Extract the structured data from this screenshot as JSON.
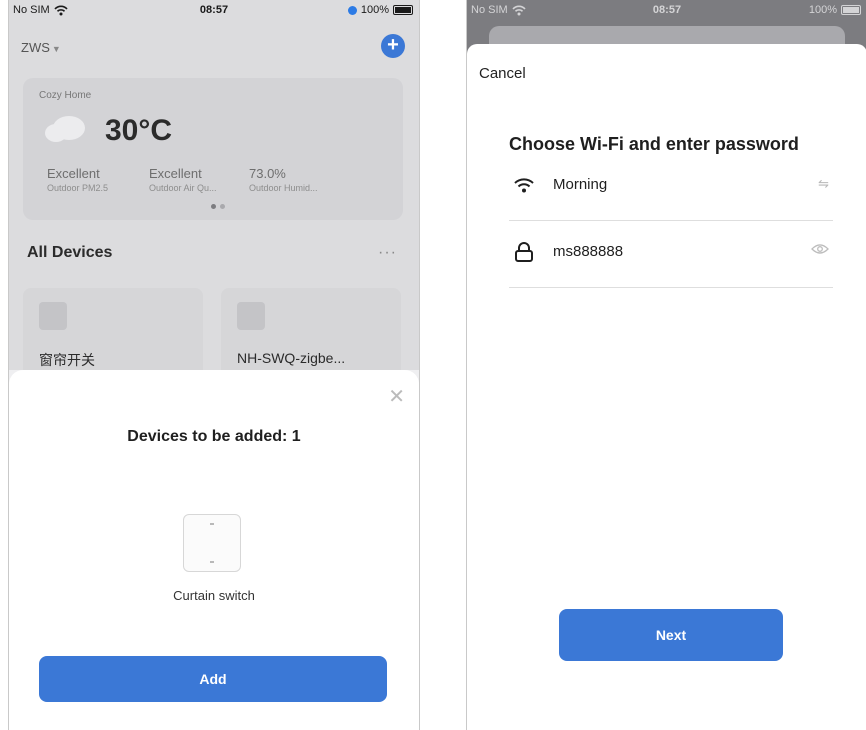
{
  "left_phone": {
    "status": {
      "carrier": "No SIM",
      "time": "08:57",
      "battery": "100%"
    },
    "home": {
      "name": "ZWS",
      "weather": {
        "label": "Cozy Home",
        "temperature": "30°C",
        "stats": [
          {
            "value": "Excellent",
            "label": "Outdoor PM2.5"
          },
          {
            "value": "Excellent",
            "label": "Outdoor Air Qu..."
          },
          {
            "value": "73.0%",
            "label": "Outdoor Humid..."
          }
        ]
      },
      "section_title": "All Devices",
      "more_label": "···",
      "devices": [
        {
          "name": "窗帘开关"
        },
        {
          "name": "NH-SWQ-zigbe..."
        }
      ]
    },
    "sheet": {
      "close_label": "✕",
      "title": "Devices to be added: 1",
      "device_label": "Curtain switch",
      "add_label": "Add"
    }
  },
  "right_phone": {
    "status": {
      "carrier": "No SIM",
      "time": "08:57",
      "battery": "100%"
    },
    "cancel_label": "Cancel",
    "title": "Choose Wi-Fi and enter password",
    "wifi_name": "Morning",
    "password": "ms888888",
    "next_label": "Next"
  },
  "colors": {
    "accent": "#3b78d6",
    "dim_overlay": "#7c7c80"
  },
  "icons": [
    "wifi-icon",
    "battery-icon",
    "add-icon",
    "cloud-icon",
    "close-icon",
    "lock-icon",
    "switch-network-icon",
    "eye-icon"
  ]
}
